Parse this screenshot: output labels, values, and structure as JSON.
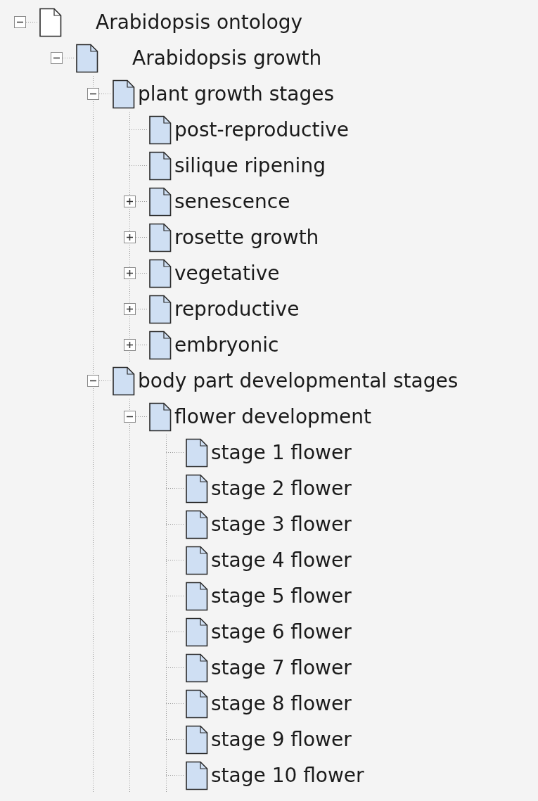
{
  "tree": [
    {
      "label": "Arabidopsis ontology",
      "expanded": true,
      "children": [
        {
          "label": "Arabidopsis growth",
          "expanded": true,
          "children": [
            {
              "label": "plant growth stages",
              "expanded": true,
              "children": [
                {
                  "label": "post-reproductive"
                },
                {
                  "label": "silique ripening"
                },
                {
                  "label": "senescence",
                  "expanded": false
                },
                {
                  "label": "rosette growth",
                  "expanded": false
                },
                {
                  "label": "vegetative",
                  "expanded": false
                },
                {
                  "label": "reproductive",
                  "expanded": false
                },
                {
                  "label": "embryonic",
                  "expanded": false
                }
              ]
            },
            {
              "label": "body part developmental stages",
              "expanded": true,
              "children": [
                {
                  "label": "flower development",
                  "expanded": true,
                  "children": [
                    {
                      "label": "stage 1 flower"
                    },
                    {
                      "label": "stage 2 flower"
                    },
                    {
                      "label": "stage 3 flower"
                    },
                    {
                      "label": "stage 4 flower"
                    },
                    {
                      "label": "stage 5 flower"
                    },
                    {
                      "label": "stage 6 flower"
                    },
                    {
                      "label": "stage 7 flower"
                    },
                    {
                      "label": "stage 8 flower"
                    },
                    {
                      "label": "stage 9 flower"
                    },
                    {
                      "label": "stage 10 flower"
                    }
                  ]
                }
              ]
            }
          ]
        }
      ]
    }
  ]
}
